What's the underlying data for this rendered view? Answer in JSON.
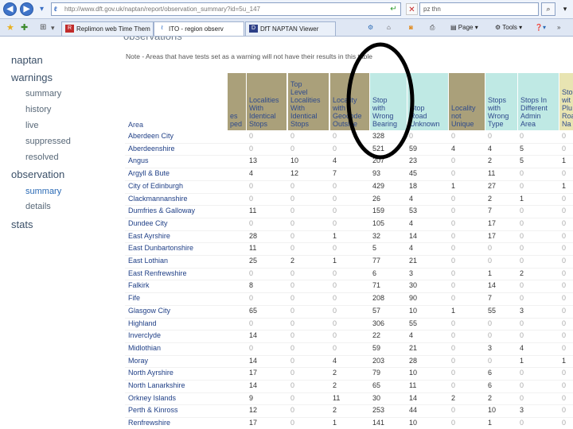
{
  "browser": {
    "url": "http://www.dft.gov.uk/naptan/report/observation_summary?id=5u_147",
    "search_value": "pz thn",
    "tabs": [
      {
        "label": "Replimon web Time Them",
        "active": false
      },
      {
        "label": "ITO - region observ",
        "active": true
      },
      {
        "label": "DfT NAPTAN Viewer",
        "active": false
      }
    ],
    "toolbar": {
      "page_label": "Page",
      "tools_label": "Tools"
    }
  },
  "page": {
    "title": "observations",
    "note": "Note - Areas that have tests set as a warning will not have their results in this table"
  },
  "sidebar": {
    "items": [
      {
        "label": "naptan",
        "level": 1
      },
      {
        "label": "warnings",
        "level": 1
      },
      {
        "label": "summary",
        "level": 2
      },
      {
        "label": "history",
        "level": 2
      },
      {
        "label": "live",
        "level": 2
      },
      {
        "label": "suppressed",
        "level": 2
      },
      {
        "label": "resolved",
        "level": 2
      },
      {
        "label": "observation",
        "level": 1
      },
      {
        "label": "summary",
        "level": 2,
        "active": true
      },
      {
        "label": "details",
        "level": 2
      },
      {
        "label": "stats",
        "level": 1
      }
    ]
  },
  "table": {
    "area_header": "Area",
    "columns": [
      {
        "label": "es\nped",
        "color": "olive"
      },
      {
        "label": "Localities\nWith\nIdentical\nStops",
        "color": "olive"
      },
      {
        "label": "Top\nLevel\nLocalities\nWith\nIdentical\nStops",
        "color": "olive"
      },
      {
        "label": "Locality\nwith\nGeocode\nOutside",
        "color": "olive"
      },
      {
        "label": "Stop\nwith\nWrong\nBearing",
        "color": "cyan"
      },
      {
        "label": "Stop\nRoad\nUnknown",
        "color": "cyan"
      },
      {
        "label": "Locality\nnot\nUnique",
        "color": "olive"
      },
      {
        "label": "Stops\nwith\nWrong\nType",
        "color": "cyan"
      },
      {
        "label": "Stops In\nDifferent\nAdmin\nArea",
        "color": "cyan"
      },
      {
        "label": "Sto\nwit\nPlu\nRoa\nNa",
        "color": "cream"
      }
    ],
    "rows": [
      {
        "area": "Aberdeen City",
        "v": [
          "0",
          "0",
          "0",
          "328",
          "0",
          "0",
          "0",
          "0",
          "0"
        ]
      },
      {
        "area": "Aberdeenshire",
        "v": [
          "0",
          "0",
          "0",
          "521",
          "59",
          "4",
          "4",
          "5",
          "0"
        ]
      },
      {
        "area": "Angus",
        "v": [
          "13",
          "10",
          "4",
          "207",
          "23",
          "0",
          "2",
          "5",
          "1"
        ]
      },
      {
        "area": "Argyll & Bute",
        "v": [
          "4",
          "12",
          "7",
          "93",
          "45",
          "0",
          "11",
          "0",
          "0"
        ]
      },
      {
        "area": "City of Edinburgh",
        "v": [
          "0",
          "0",
          "0",
          "429",
          "18",
          "1",
          "27",
          "0",
          "1"
        ]
      },
      {
        "area": "Clackmannanshire",
        "v": [
          "0",
          "0",
          "0",
          "26",
          "4",
          "0",
          "2",
          "1",
          "0"
        ]
      },
      {
        "area": "Dumfries & Galloway",
        "v": [
          "11",
          "0",
          "0",
          "159",
          "53",
          "0",
          "7",
          "0",
          "0"
        ]
      },
      {
        "area": "Dundee City",
        "v": [
          "0",
          "0",
          "0",
          "105",
          "4",
          "0",
          "17",
          "0",
          "0"
        ]
      },
      {
        "area": "East Ayrshire",
        "v": [
          "28",
          "0",
          "1",
          "32",
          "14",
          "0",
          "17",
          "0",
          "0"
        ]
      },
      {
        "area": "East Dunbartonshire",
        "v": [
          "11",
          "0",
          "0",
          "5",
          "4",
          "0",
          "0",
          "0",
          "0"
        ]
      },
      {
        "area": "East Lothian",
        "v": [
          "25",
          "2",
          "1",
          "77",
          "21",
          "0",
          "0",
          "0",
          "0"
        ]
      },
      {
        "area": "East Renfrewshire",
        "v": [
          "0",
          "0",
          "0",
          "6",
          "3",
          "0",
          "1",
          "2",
          "0"
        ]
      },
      {
        "area": "Falkirk",
        "v": [
          "8",
          "0",
          "0",
          "71",
          "30",
          "0",
          "14",
          "0",
          "0"
        ]
      },
      {
        "area": "Fife",
        "v": [
          "0",
          "0",
          "0",
          "208",
          "90",
          "0",
          "7",
          "0",
          "0"
        ]
      },
      {
        "area": "Glasgow City",
        "v": [
          "65",
          "0",
          "0",
          "57",
          "10",
          "1",
          "55",
          "3",
          "0"
        ]
      },
      {
        "area": "Highland",
        "v": [
          "0",
          "0",
          "0",
          "306",
          "55",
          "0",
          "0",
          "0",
          "0"
        ]
      },
      {
        "area": "Inverclyde",
        "v": [
          "14",
          "0",
          "0",
          "22",
          "4",
          "0",
          "0",
          "0",
          "0"
        ]
      },
      {
        "area": "Midlothian",
        "v": [
          "0",
          "0",
          "0",
          "59",
          "21",
          "0",
          "3",
          "4",
          "0"
        ]
      },
      {
        "area": "Moray",
        "v": [
          "14",
          "0",
          "4",
          "203",
          "28",
          "0",
          "0",
          "1",
          "1"
        ]
      },
      {
        "area": "North Ayrshire",
        "v": [
          "17",
          "0",
          "2",
          "79",
          "10",
          "0",
          "6",
          "0",
          "0"
        ]
      },
      {
        "area": "North Lanarkshire",
        "v": [
          "14",
          "0",
          "2",
          "65",
          "11",
          "0",
          "6",
          "0",
          "0"
        ]
      },
      {
        "area": "Orkney Islands",
        "v": [
          "9",
          "0",
          "11",
          "30",
          "14",
          "2",
          "2",
          "0",
          "0"
        ]
      },
      {
        "area": "Perth & Kinross",
        "v": [
          "12",
          "0",
          "2",
          "253",
          "44",
          "0",
          "10",
          "3",
          "0"
        ]
      },
      {
        "area": "Renfrewshire",
        "v": [
          "17",
          "0",
          "1",
          "141",
          "10",
          "0",
          "1",
          "0",
          "0"
        ]
      }
    ]
  },
  "colors": {
    "olive": "#aaa07a",
    "cyan": "#bfe9e4",
    "cream": "#e8e4b2",
    "annotation": "#000000"
  }
}
